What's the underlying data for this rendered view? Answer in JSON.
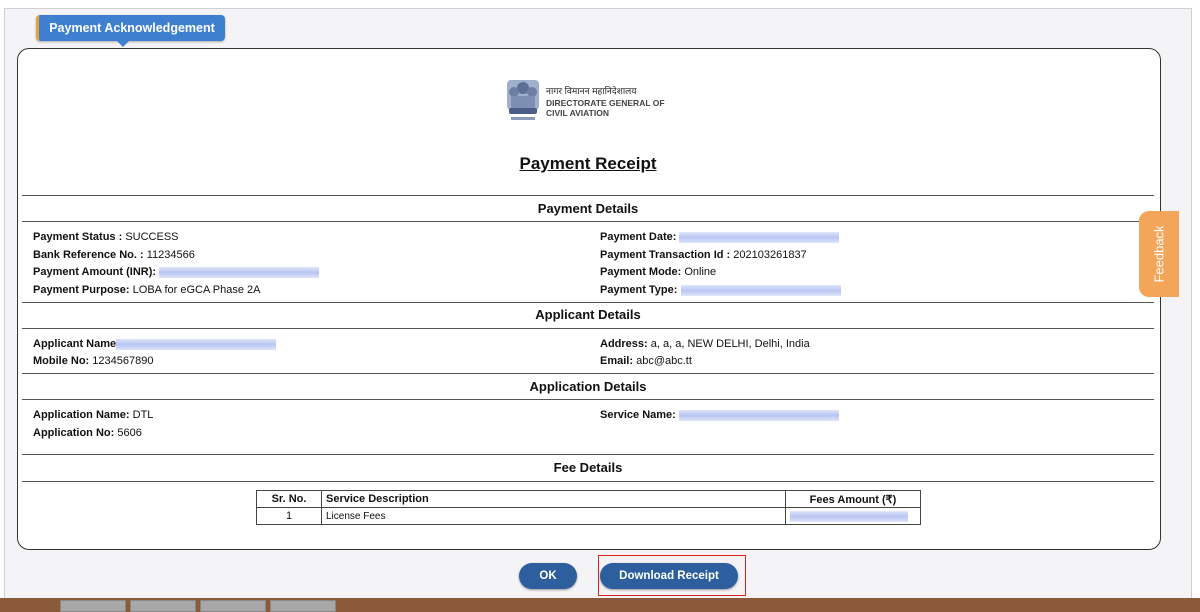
{
  "tab_title": "Payment Acknowledgement",
  "logo": {
    "hindi": "नागर विमानन महानिदेशालय",
    "line1": "DIRECTORATE GENERAL OF",
    "line2": "CIVIL AVIATION"
  },
  "receipt_title": "Payment Receipt",
  "sections": {
    "payment": "Payment Details",
    "applicant": "Applicant Details",
    "application": "Application Details",
    "fee": "Fee Details"
  },
  "payment": {
    "status_label": "Payment Status :",
    "status_value": "SUCCESS",
    "bank_ref_label": "Bank Reference No. :",
    "bank_ref_value": "11234566",
    "amount_label": "Payment Amount (INR):",
    "purpose_label": "Payment Purpose:",
    "purpose_value": "LOBA for eGCA Phase 2A",
    "date_label": "Payment Date:",
    "txn_label": "Payment Transaction Id :",
    "txn_value": "202103261837",
    "mode_label": "Payment Mode:",
    "mode_value": "Online",
    "type_label": "Payment Type:"
  },
  "applicant": {
    "name_label": "Applicant Name",
    "mobile_label": "Mobile No:",
    "mobile_value": "1234567890",
    "address_label": "Address:",
    "address_value": "a, a, a, NEW DELHI, Delhi, India",
    "email_label": "Email:",
    "email_value": "abc@abc.tt"
  },
  "application": {
    "name_label": "Application Name:",
    "name_value": "DTL",
    "no_label": "Application No:",
    "no_value": "5606",
    "service_label": "Service Name:"
  },
  "fee_table": {
    "headers": [
      "Sr. No.",
      "Service Description",
      "Fees Amount (₹)"
    ],
    "rows": [
      {
        "sr": "1",
        "desc": "License Fees"
      }
    ]
  },
  "feedback_label": "Feedback",
  "buttons": {
    "ok": "OK",
    "download": "Download Receipt"
  }
}
